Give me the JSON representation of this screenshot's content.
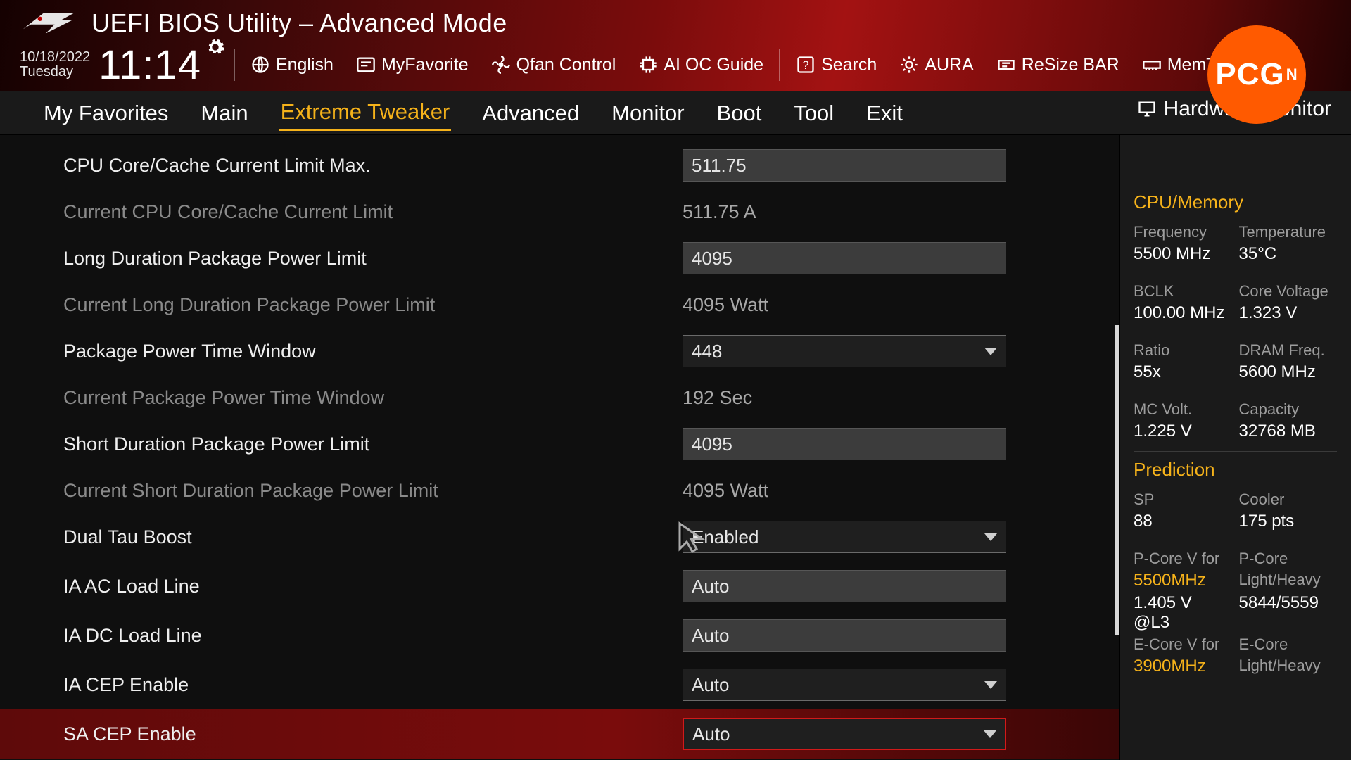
{
  "header": {
    "title": "UEFI BIOS Utility – Advanced Mode",
    "date": "10/18/2022",
    "weekday": "Tuesday",
    "time": "11:14",
    "links": {
      "language": "English",
      "favorite": "MyFavorite",
      "qfan": "Qfan Control",
      "aioc": "AI OC Guide",
      "search": "Search",
      "aura": "AURA",
      "resizebar": "ReSize BAR",
      "memtest": "MemTest86"
    }
  },
  "tabs": [
    "My Favorites",
    "Main",
    "Extreme Tweaker",
    "Advanced",
    "Monitor",
    "Boot",
    "Tool",
    "Exit"
  ],
  "active_tab_index": 2,
  "hwmon_title": "Hardware Monitor",
  "settings": [
    {
      "type": "input",
      "label": "CPU Core/Cache Current Limit Max.",
      "value": "511.75"
    },
    {
      "type": "info",
      "label": "Current CPU Core/Cache Current Limit",
      "value": "511.75 A"
    },
    {
      "type": "input",
      "label": "Long Duration Package Power Limit",
      "value": "4095"
    },
    {
      "type": "info",
      "label": "Current Long Duration Package Power Limit",
      "value": "4095 Watt"
    },
    {
      "type": "dropdown",
      "label": "Package Power Time Window",
      "value": "448"
    },
    {
      "type": "info",
      "label": "Current Package Power Time Window",
      "value": "192 Sec"
    },
    {
      "type": "input",
      "label": "Short Duration Package Power Limit",
      "value": "4095"
    },
    {
      "type": "info",
      "label": "Current Short Duration Package Power Limit",
      "value": "4095 Watt"
    },
    {
      "type": "dropdown",
      "label": "Dual Tau Boost",
      "value": "Enabled"
    },
    {
      "type": "input",
      "label": "IA AC Load Line",
      "value": "Auto"
    },
    {
      "type": "input",
      "label": "IA DC Load Line",
      "value": "Auto"
    },
    {
      "type": "dropdown",
      "label": "IA CEP Enable",
      "value": "Auto"
    },
    {
      "type": "dropdown",
      "label": "SA CEP Enable",
      "value": "Auto",
      "selected": true
    }
  ],
  "monitor": {
    "cpu_title": "CPU/Memory",
    "cpu": [
      {
        "l1": "Frequency",
        "v1": "5500 MHz",
        "l2": "Temperature",
        "v2": "35°C"
      },
      {
        "l1": "BCLK",
        "v1": "100.00 MHz",
        "l2": "Core Voltage",
        "v2": "1.323 V"
      },
      {
        "l1": "Ratio",
        "v1": "55x",
        "l2": "DRAM Freq.",
        "v2": "5600 MHz"
      },
      {
        "l1": "MC Volt.",
        "v1": "1.225 V",
        "l2": "Capacity",
        "v2": "32768 MB"
      }
    ],
    "pred_title": "Prediction",
    "pred_top": {
      "l1": "SP",
      "v1": "88",
      "l2": "Cooler",
      "v2": "175 pts"
    },
    "pcore": {
      "l1a": "P-Core V for",
      "l1b_yellow": "5500MHz",
      "v1": "1.405 V @L3",
      "l2a": "P-Core",
      "l2b": "Light/Heavy",
      "v2": "5844/5559"
    },
    "ecore": {
      "l1a": "E-Core V for",
      "l1b_yellow": "3900MHz",
      "l2a": "E-Core",
      "l2b": "Light/Heavy"
    }
  },
  "badge": {
    "text": "PCG",
    "sup": "N"
  }
}
